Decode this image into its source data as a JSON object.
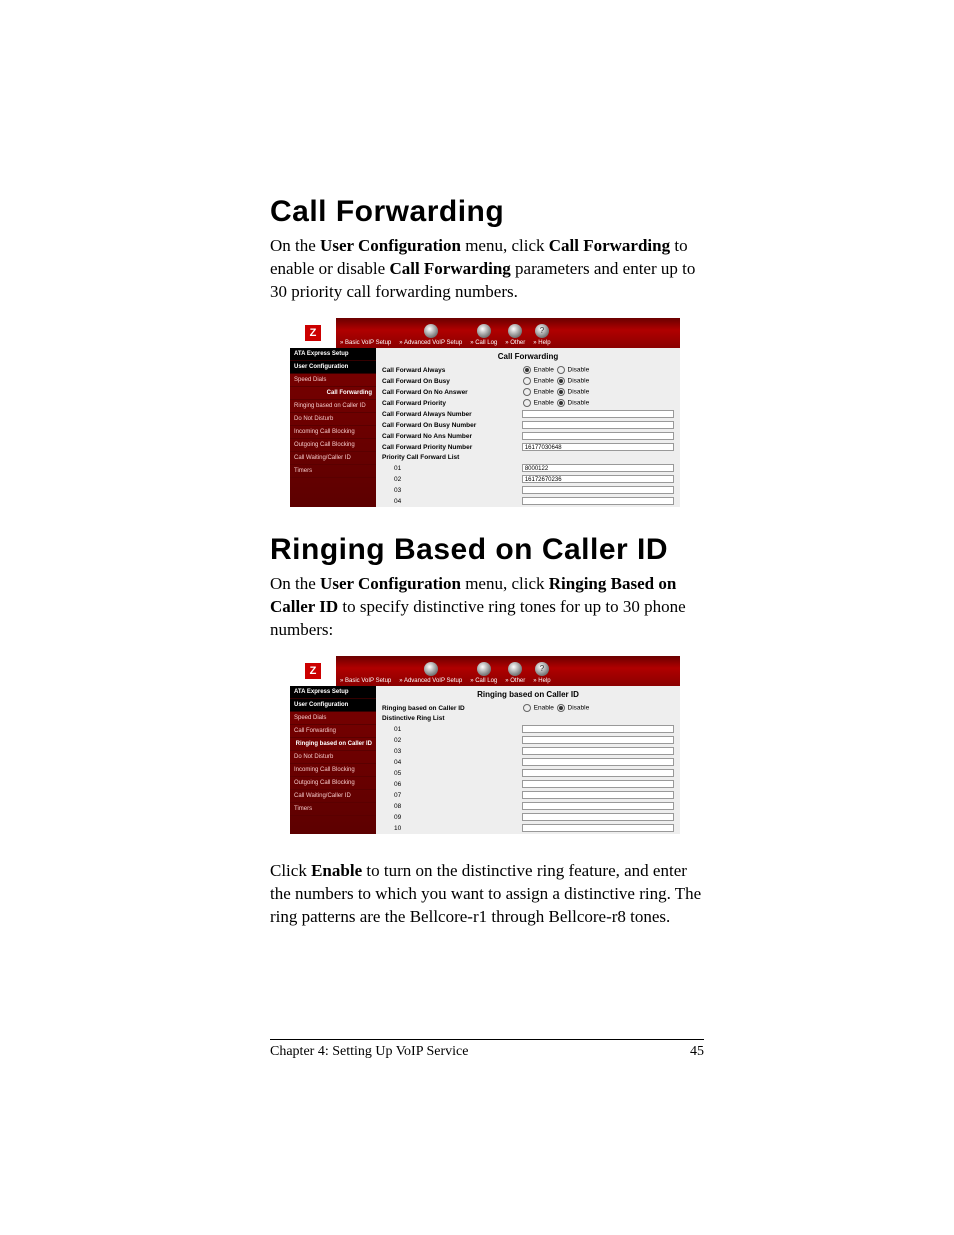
{
  "section1": {
    "heading": "Call Forwarding",
    "p_pre": "On the ",
    "p_b1": "User Configuration",
    "p_mid1": " menu, click ",
    "p_b2": "Call Forwarding",
    "p_post": " to enable or disable ",
    "p_b3": "Call Forwarding",
    "p_tail": " parameters and enter up to 30 priority call forwarding numbers."
  },
  "nav": {
    "brand": "zoom",
    "items": [
      "» Basic VoIP Setup",
      "» Advanced VoIP Setup",
      "» Call Log",
      "» Other",
      "» Help"
    ],
    "help_glyph": "?"
  },
  "sidebar": {
    "hdr1": "ATA Express Setup",
    "hdr2": "User Configuration",
    "items": [
      "Speed Dials",
      "Call Forwarding",
      "Ringing based on Caller ID",
      "Do Not Disturb",
      "Incoming Call Blocking",
      "Outgoing Call Blocking",
      "Call Waiting/Caller ID",
      "Timers"
    ]
  },
  "cf": {
    "title": "Call Forwarding",
    "rows_toggle": [
      {
        "label": "Call Forward Always",
        "sel": "enable"
      },
      {
        "label": "Call Forward On Busy",
        "sel": "disable"
      },
      {
        "label": "Call Forward On No Answer",
        "sel": "disable"
      },
      {
        "label": "Call Forward Priority",
        "sel": "disable"
      }
    ],
    "rows_num": [
      {
        "label": "Call Forward Always Number",
        "val": ""
      },
      {
        "label": "Call Forward On Busy Number",
        "val": ""
      },
      {
        "label": "Call Forward No Ans Number",
        "val": ""
      },
      {
        "label": "Call Forward Priority Number",
        "val": "16177030648"
      }
    ],
    "list_label": "Priority Call Forward List",
    "list": [
      {
        "n": "01",
        "val": "8000122"
      },
      {
        "n": "02",
        "val": "16172670236"
      },
      {
        "n": "03",
        "val": ""
      },
      {
        "n": "04",
        "val": ""
      }
    ],
    "opt_enable": "Enable",
    "opt_disable": "Disable"
  },
  "section2": {
    "heading": "Ringing Based on Caller ID",
    "p_pre": "On the ",
    "p_b1": "User Configuration",
    "p_mid1": " menu, click ",
    "p_b2": "Ringing Based on Caller ID",
    "p_post": " to specify distinctive ring tones for up to 30 phone numbers:"
  },
  "rb": {
    "title": "Ringing based on Caller ID",
    "toggle_label": "Ringing based on Caller ID",
    "list_label": "Distinctive Ring List",
    "rows": [
      "01",
      "02",
      "03",
      "04",
      "05",
      "06",
      "07",
      "08",
      "09",
      "10"
    ],
    "opt_enable": "Enable",
    "opt_disable": "Disable"
  },
  "para3": {
    "pre": "Click ",
    "b1": "Enable",
    "post": " to turn on the distinctive ring feature, and enter the numbers to which you want to assign a distinctive ring. The ring patterns are the Bellcore-r1 through Bellcore-r8 tones."
  },
  "footer": {
    "left": "Chapter 4: Setting Up VoIP Service",
    "right": "45"
  }
}
